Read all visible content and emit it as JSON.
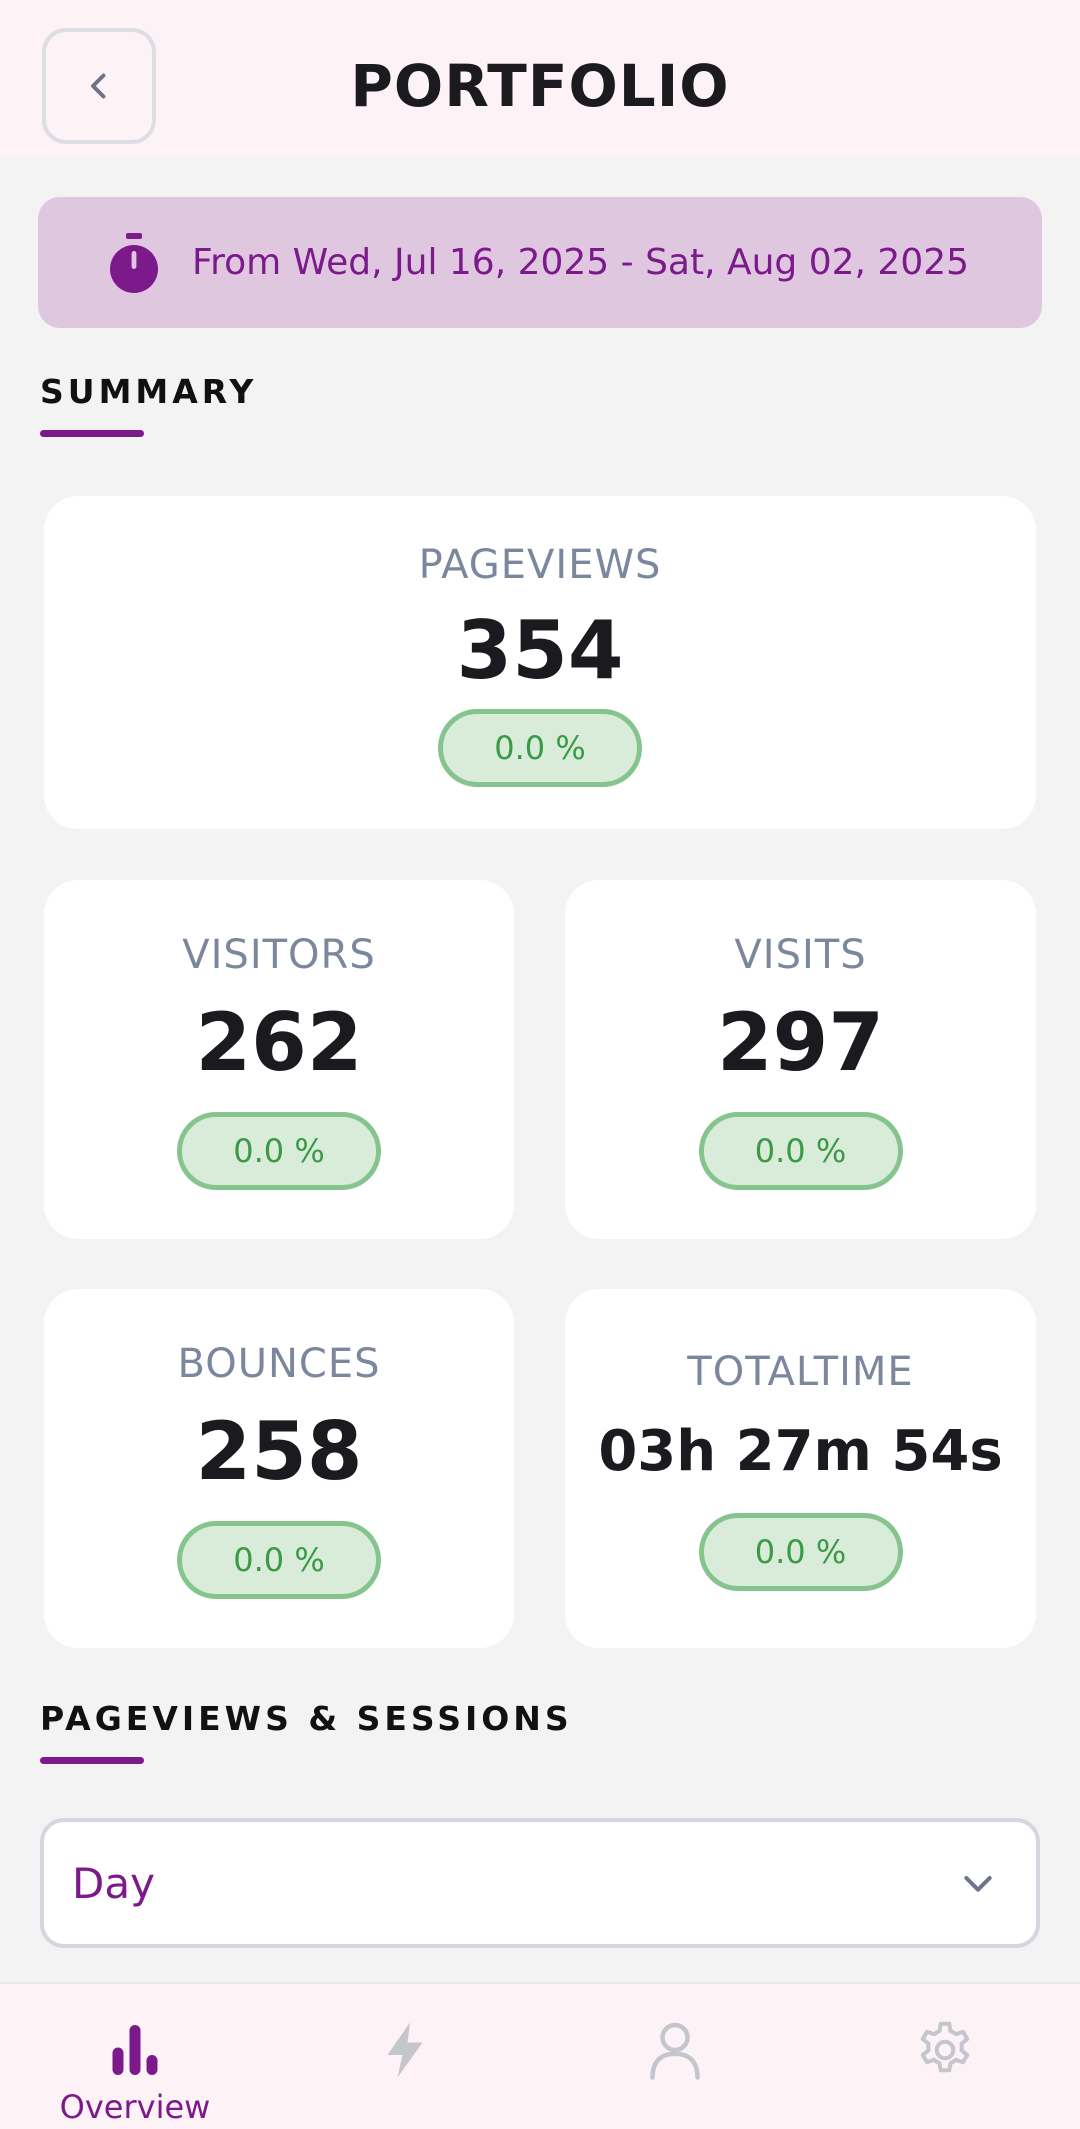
{
  "header": {
    "title": "PORTFOLIO",
    "back_icon": "chevron-left-icon"
  },
  "date_range": {
    "icon": "stopwatch-icon",
    "text": "From Wed, Jul 16, 2025 - Sat, Aug 02, 2025"
  },
  "summary": {
    "title": "SUMMARY",
    "cards": {
      "pageviews": {
        "label": "PAGEVIEWS",
        "value": "354",
        "change": "0.0 %"
      },
      "visitors": {
        "label": "VISITORS",
        "value": "262",
        "change": "0.0 %"
      },
      "visits": {
        "label": "VISITS",
        "value": "297",
        "change": "0.0 %"
      },
      "bounces": {
        "label": "BOUNCES",
        "value": "258",
        "change": "0.0 %"
      },
      "totaltime": {
        "label": "TOTALTIME",
        "value": "03h 27m 54s",
        "change": "0.0 %"
      }
    }
  },
  "sessions": {
    "title": "PAGEVIEWS & SESSIONS",
    "period_select": {
      "value": "Day"
    }
  },
  "bottom_nav": {
    "items": [
      {
        "label": "Overview",
        "icon": "bar-chart-icon",
        "active": true
      },
      {
        "label": "",
        "icon": "lightning-icon",
        "active": false
      },
      {
        "label": "",
        "icon": "user-icon",
        "active": false
      },
      {
        "label": "",
        "icon": "gear-icon",
        "active": false
      }
    ]
  },
  "colors": {
    "accent": "#7c1a8c",
    "banner_bg": "#dfc7e0",
    "positive": "#3a9a45",
    "muted_label": "#7b879c",
    "inactive_icon": "#c5c5cc"
  }
}
